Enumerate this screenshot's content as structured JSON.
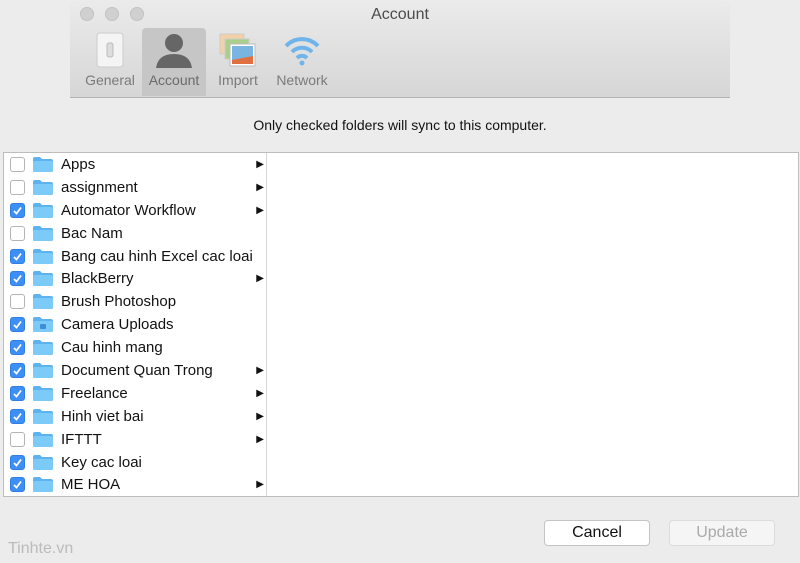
{
  "window": {
    "title": "Account"
  },
  "tabs": [
    {
      "label": "General",
      "icon": "switch-icon"
    },
    {
      "label": "Account",
      "icon": "user-icon",
      "active": true
    },
    {
      "label": "Import",
      "icon": "photos-icon"
    },
    {
      "label": "Network",
      "icon": "wifi-icon"
    }
  ],
  "info": "Only checked folders will sync to this computer.",
  "folders": [
    {
      "name": "Apps",
      "checked": false,
      "sub": true
    },
    {
      "name": "assignment",
      "checked": false,
      "sub": true
    },
    {
      "name": "Automator Workflow",
      "checked": true,
      "sub": true
    },
    {
      "name": "Bac Nam",
      "checked": false,
      "sub": false
    },
    {
      "name": "Bang cau hinh Excel cac loai",
      "checked": true,
      "sub": false
    },
    {
      "name": "BlackBerry",
      "checked": true,
      "sub": true
    },
    {
      "name": "Brush Photoshop",
      "checked": false,
      "sub": false
    },
    {
      "name": "Camera Uploads",
      "checked": true,
      "sub": false,
      "camera": true
    },
    {
      "name": "Cau hinh mang",
      "checked": true,
      "sub": false
    },
    {
      "name": "Document Quan Trong",
      "checked": true,
      "sub": true
    },
    {
      "name": "Freelance",
      "checked": true,
      "sub": true
    },
    {
      "name": "Hinh viet bai",
      "checked": true,
      "sub": true
    },
    {
      "name": "IFTTT",
      "checked": false,
      "sub": true
    },
    {
      "name": "Key cac loai",
      "checked": true,
      "sub": false
    },
    {
      "name": "ME HOA",
      "checked": true,
      "sub": true
    }
  ],
  "buttons": {
    "cancel": "Cancel",
    "update": "Update"
  },
  "watermark": "Tinhte.vn",
  "colors": {
    "accent": "#3d8ef5",
    "folder": "#6cc0f5"
  }
}
